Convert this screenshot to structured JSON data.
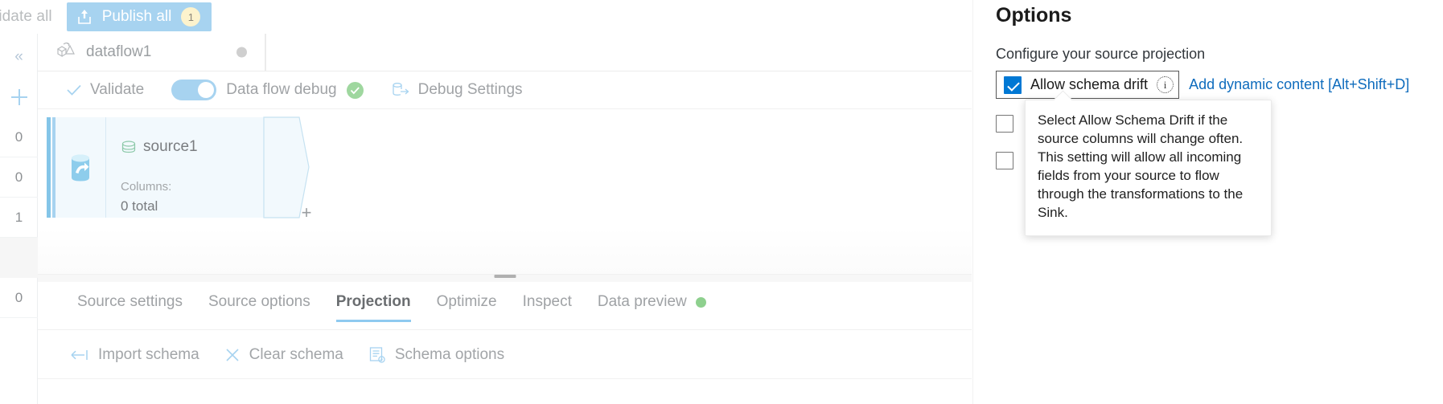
{
  "command_bar": {
    "validate_all_label": "lidate all",
    "publish_all_label": "Publish all",
    "publish_badge": "1",
    "publish_icon": "upload-icon"
  },
  "rail": {
    "collapse_icon": "chevron-double-left-icon",
    "add_icon": "plus-icon",
    "counts": [
      "0",
      "0",
      "1",
      "",
      "0"
    ]
  },
  "dataflow_tab": {
    "name": "dataflow1",
    "icon": "dataflow-icon",
    "status_dot": "gray-status-dot"
  },
  "debug_toolbar": {
    "validate_label": "Validate",
    "validate_icon": "checkmark-icon",
    "data_flow_debug_label": "Data flow debug",
    "debug_toggle_on": true,
    "debug_status_icon": "green-check-circle-icon",
    "debug_settings_label": "Debug Settings",
    "debug_settings_icon": "database-arrow-icon"
  },
  "canvas": {
    "node": {
      "title": "source1",
      "title_icon": "source-stack-icon",
      "type_icon": "azure-data-source-icon",
      "columns_label": "Columns:",
      "columns_value": "0 total"
    },
    "add_node_icon": "plus-icon"
  },
  "bottom_panel": {
    "tabs": [
      {
        "label": "Source settings",
        "active": false
      },
      {
        "label": "Source options",
        "active": false
      },
      {
        "label": "Projection",
        "active": true
      },
      {
        "label": "Optimize",
        "active": false
      },
      {
        "label": "Inspect",
        "active": false
      },
      {
        "label": "Data preview",
        "active": false,
        "dot": "green-status-dot"
      }
    ],
    "schema_toolbar": [
      {
        "label": "Import schema",
        "icon": "import-arrow-icon"
      },
      {
        "label": "Clear schema",
        "icon": "close-x-icon"
      },
      {
        "label": "Schema options",
        "icon": "schema-options-icon"
      }
    ]
  },
  "options_panel": {
    "title": "Options",
    "subtitle": "Configure your source projection",
    "allow_schema_drift": {
      "label": "Allow schema drift",
      "checked": true,
      "info_icon": "info-icon"
    },
    "dynamic_content_link": "Add dynamic content [Alt+Shift+D]",
    "tooltip": "Select Allow Schema Drift if the source columns will change often. This setting will allow all incoming fields from your source to flow through the transformations to the Sink.",
    "extra_checkboxes": [
      {
        "checked": false
      },
      {
        "checked": false
      }
    ]
  },
  "colors": {
    "accent_blue": "#0078d4",
    "link_blue": "#0f6cbd",
    "light_blue": "#a7d3f0",
    "green": "#8ed08e",
    "badge_yellow": "#fdf3cd"
  }
}
